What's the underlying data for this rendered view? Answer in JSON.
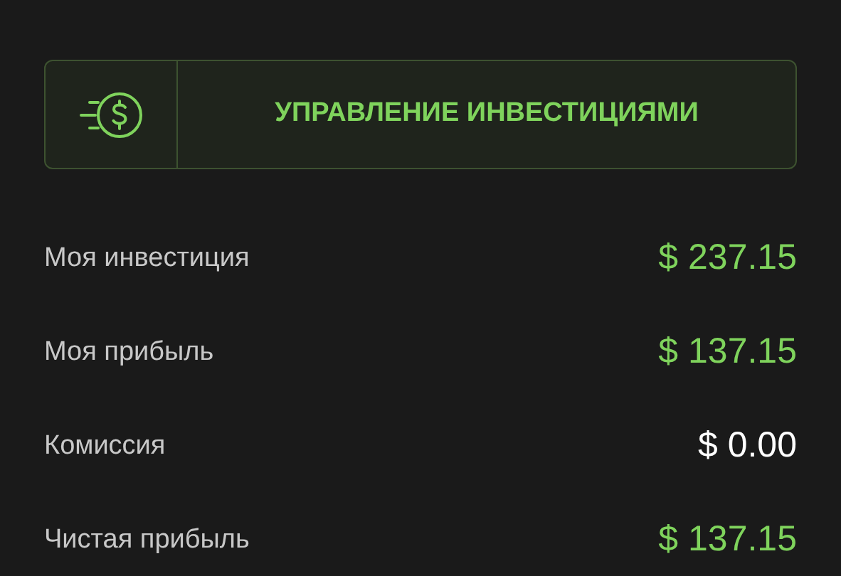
{
  "action_button": {
    "label": "УПРАВЛЕНИЕ ИНВЕСТИЦИЯМИ"
  },
  "rows": [
    {
      "label": "Моя инвестиция",
      "value": "$ 237.15",
      "color": "#7fd35c"
    },
    {
      "label": "Моя прибыль",
      "value": "$ 137.15",
      "color": "#7fd35c"
    },
    {
      "label": "Комиссия",
      "value": "$ 0.00",
      "color": "#ffffff"
    },
    {
      "label": "Чистая прибыль",
      "value": "$ 137.15",
      "color": "#7fd35c"
    }
  ]
}
